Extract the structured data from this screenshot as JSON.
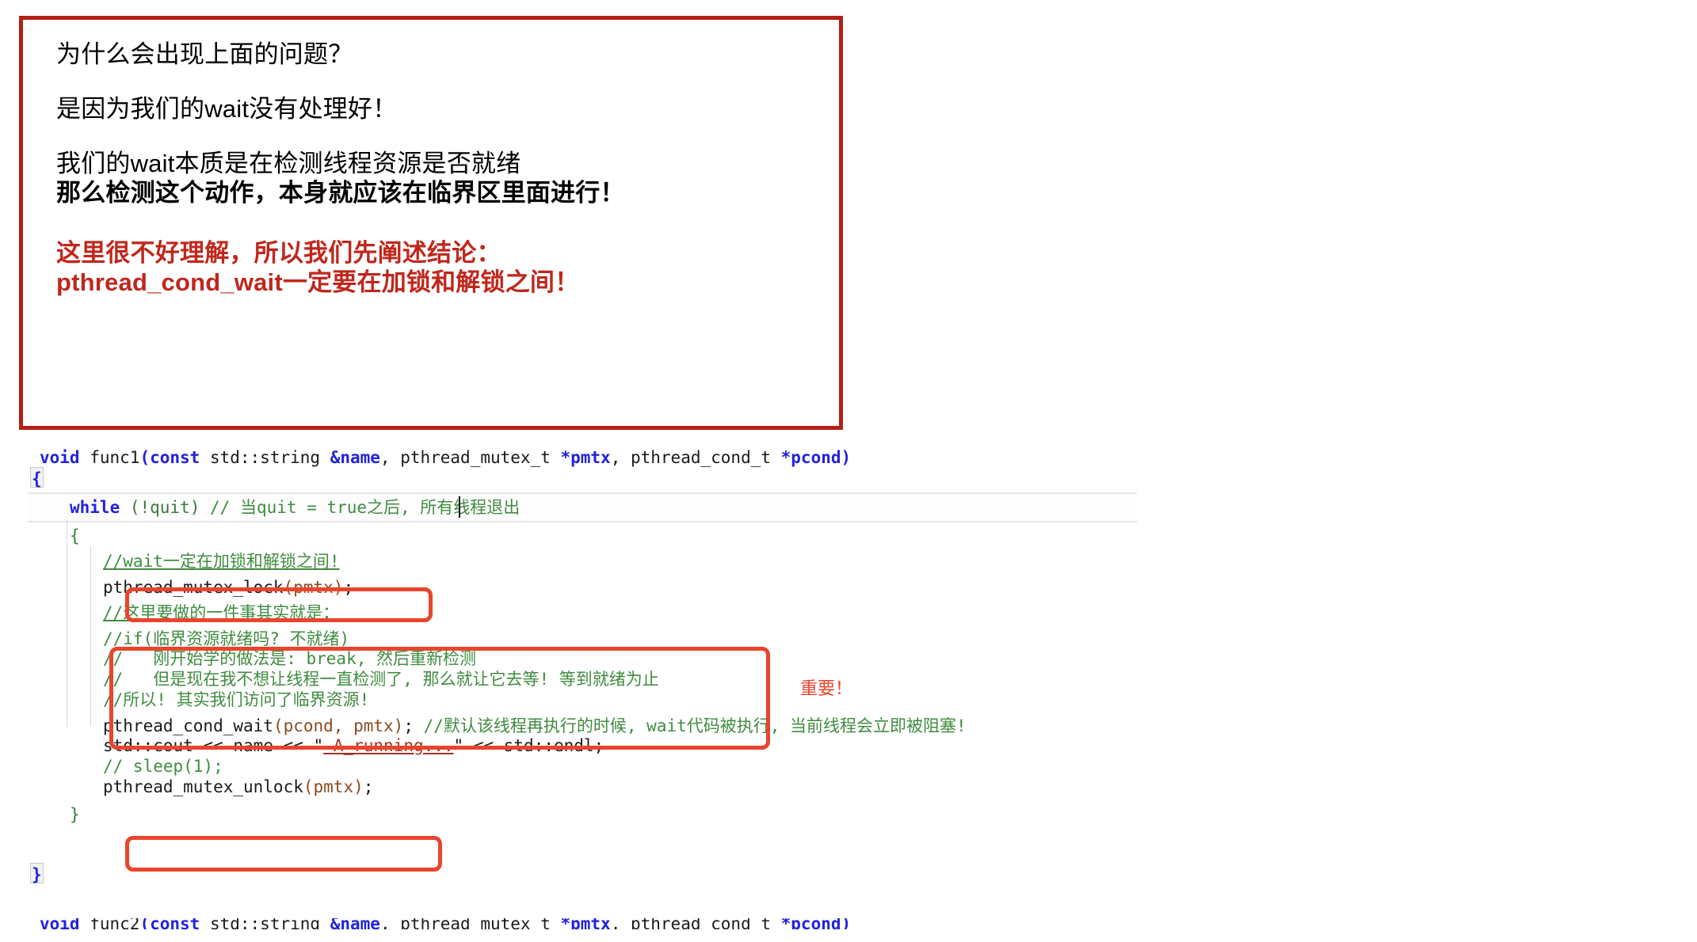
{
  "callout": {
    "lines": [
      {
        "text": "为什么会出现上面的问题？",
        "style": "normal"
      },
      {
        "text": "是因为我们的wait没有处理好！",
        "style": "normal"
      },
      {
        "text": "我们的wait本质是在检测线程资源是否就绪",
        "style": "normal"
      },
      {
        "text": "那么检测这个动作，本身就应该在临界区里面进行！",
        "style": "bold"
      },
      {
        "text": "这里很不好理解，所以我们先阐述结论：",
        "style": "red-bold"
      },
      {
        "text": "pthread_cond_wait一定要在加锁和解锁之间！",
        "style": "red-bold"
      }
    ],
    "border_color": "#b22017"
  },
  "code": {
    "language": "cpp",
    "signature": {
      "kw_void": "void",
      "fname": " func1",
      "paren_open": "(",
      "kw_const": "const",
      "type_string": " std::string ",
      "amp_name": "&name",
      "arg_rest": ", pthread_mutex_t ",
      "ptr_pmtx": "*pmtx",
      "arg_rest2": ", pthread_cond_t ",
      "ptr_pcond": "*pcond",
      "paren_close": ")"
    },
    "lines": [
      {
        "id": "l-open-brace",
        "text": "{"
      },
      {
        "id": "l-while",
        "code": "while",
        "rest": " (!quit) ",
        "comment": "// 当quit = true之后, 所有线程退出"
      },
      {
        "id": "l-inner-open",
        "text": "{"
      },
      {
        "id": "l-cmt-wait",
        "comment": "//wait一定在加锁和解锁之间!"
      },
      {
        "id": "l-lock",
        "fn": "pthread_mutex_lock",
        "args": "(pmtx)",
        "semi": ";"
      },
      {
        "id": "l-cmt-here",
        "comment": "//这里要做的一件事其实就是："
      },
      {
        "id": "l-cmt-if",
        "comment": "//if(临界资源就绪吗? 不就绪)"
      },
      {
        "id": "l-cmt-break",
        "comment": "//   刚开始学的做法是: break, 然后重新检测"
      },
      {
        "id": "l-cmt-wait2",
        "comment": "//   但是现在我不想让线程一直检测了, 那么就让它去等! 等到就绪为止"
      },
      {
        "id": "l-cmt-access",
        "comment": "//所以! 其实我们访问了临界资源!"
      },
      {
        "id": "l-condwait",
        "fn": "pthread_cond_wait",
        "args": "(pcond, pmtx)",
        "semi": ";",
        "comment": " //默认该线程再执行的时候, wait代码被执行, 当前线程会立即被阻塞!"
      },
      {
        "id": "l-cout",
        "pre": "std::cout << name << ",
        "quote1": "\"",
        "string": " A_running...",
        "quote2": "\"",
        "post": " << std::endl;"
      },
      {
        "id": "l-sleep",
        "comment": "// sleep(1);"
      },
      {
        "id": "l-unlock",
        "fn": "pthread_mutex_unlock",
        "args": "(pmtx)",
        "semi": ";"
      },
      {
        "id": "l-inner-close",
        "text": "}"
      },
      {
        "id": "l-close-brace",
        "text": "}"
      }
    ],
    "clipped_next_function": {
      "kw_void": "void",
      "fname": " func2",
      "paren_open": "(",
      "kw_const": "const",
      "type_string": " std::string ",
      "amp_name": "&name",
      "arg_rest": ", pthread_mutex_t ",
      "ptr_pmtx": "*pmtx",
      "arg_rest2": ", pthread_cond_t ",
      "ptr_pcond": "*pcond",
      "paren_close": ")"
    },
    "colors": {
      "keyword": "#2222dd",
      "comment": "#3f8c3f",
      "string": "#a33226",
      "punctuation": "#8c4a1e",
      "text": "#1a1a1a"
    }
  },
  "annotations": {
    "important_label": "重要！",
    "rect_color": "#e8452c",
    "rects": [
      {
        "name": "lock-call",
        "label": "pthread_mutex_lock highlight"
      },
      {
        "name": "comment-block",
        "label": "comment block highlight"
      },
      {
        "name": "unlock-call",
        "label": "pthread_mutex_unlock highlight"
      }
    ]
  }
}
